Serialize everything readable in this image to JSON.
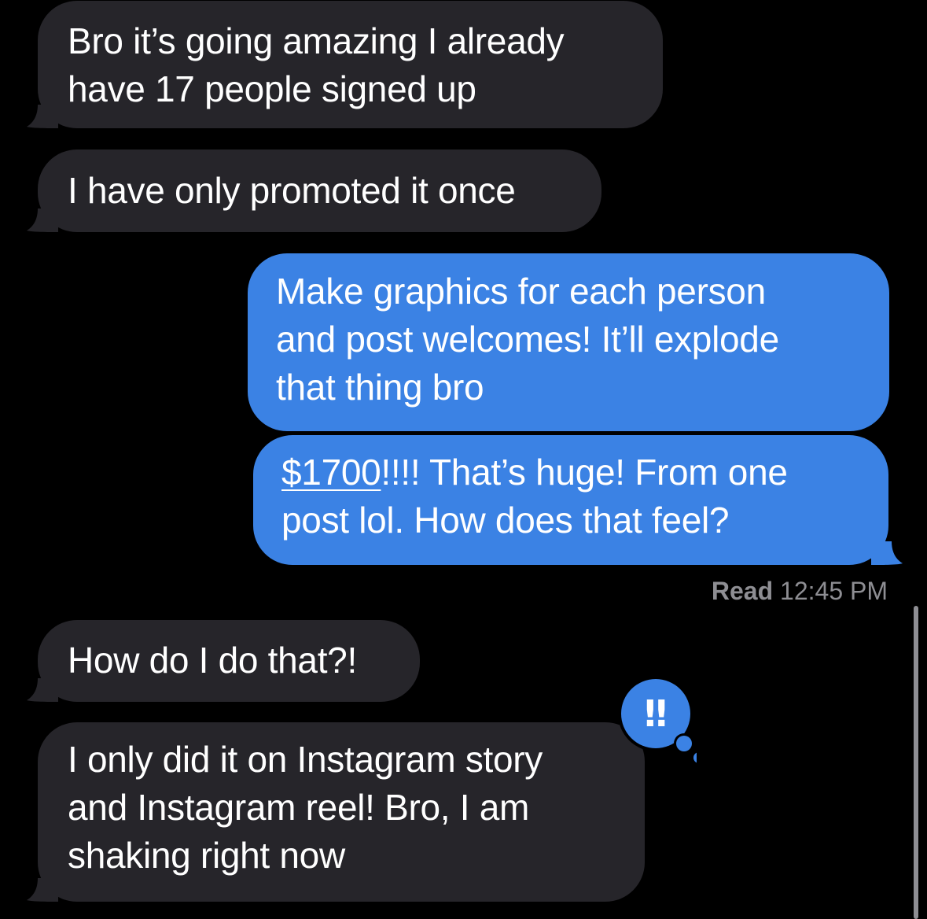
{
  "messages": [
    {
      "direction": "incoming",
      "lines": [
        "Bro it’s going amazing I already",
        "have 17 people signed up"
      ]
    },
    {
      "direction": "incoming",
      "lines": [
        "I have only promoted it once"
      ]
    },
    {
      "direction": "outgoing",
      "lines": [
        "Make graphics for each person",
        "and post welcomes! It’ll explode",
        "that thing bro"
      ]
    },
    {
      "direction": "outgoing",
      "link_text": "$1700",
      "line1_rest": "!!!! That’s huge! From one",
      "line2": "post lol. How does that feel?"
    },
    {
      "direction": "incoming",
      "lines": [
        "How do I do that?!"
      ]
    },
    {
      "direction": "incoming",
      "lines": [
        "I only did it on Instagram story",
        "and Instagram reel! Bro, I am",
        "shaking right now"
      ]
    }
  ],
  "read_receipt": {
    "label": "Read",
    "time": "12:45 PM"
  },
  "reaction": {
    "symbol": "‼",
    "icon": "emphasis-reaction-icon"
  },
  "colors": {
    "background": "#000000",
    "incoming_bubble": "#26252a",
    "outgoing_bubble": "#3b82e4",
    "text": "#ffffff",
    "meta_text": "#8e8e93"
  }
}
